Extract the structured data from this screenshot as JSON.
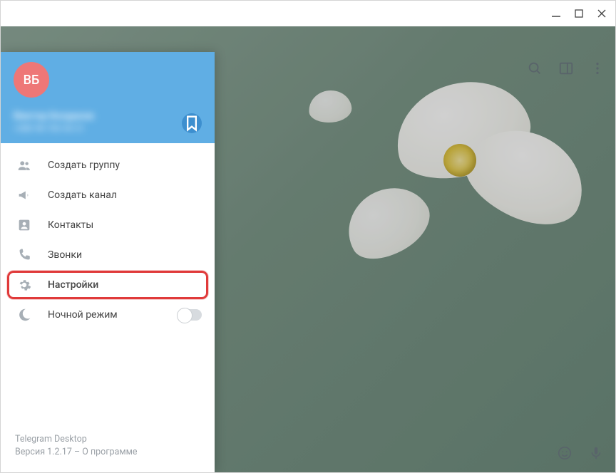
{
  "titlebar": {},
  "drawer": {
    "avatar_initials": "ВБ",
    "username": "Виктор Богданов",
    "phone": "+380 98 765 43 21",
    "menu": {
      "create_group": "Создать группу",
      "create_channel": "Создать канал",
      "contacts": "Контакты",
      "calls": "Звонки",
      "settings": "Настройки",
      "night_mode": "Ночной режим"
    },
    "night_mode_on": false,
    "footer": {
      "app_name": "Telegram Desktop",
      "version_line": "Версия 1.2.17 – О программе"
    }
  },
  "colors": {
    "accent": "#60aee4",
    "highlight": "#e03a3a",
    "avatar_bg": "#ee7777"
  }
}
